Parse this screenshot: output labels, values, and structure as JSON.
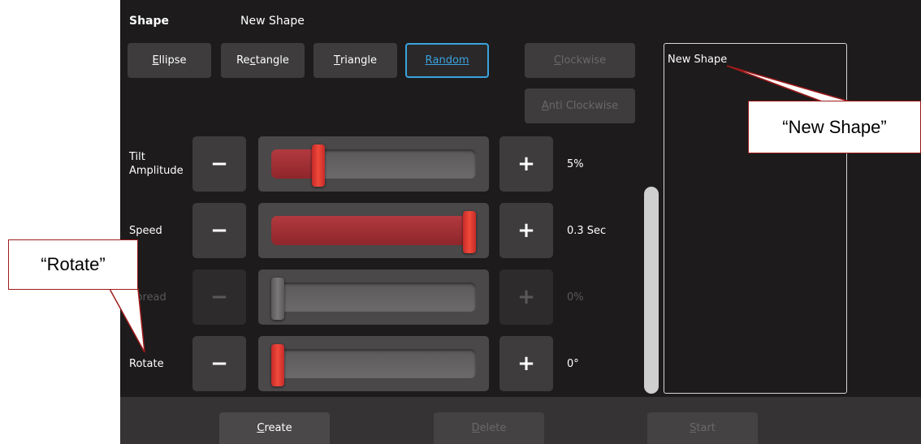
{
  "header": {
    "title": "Shape",
    "shape_name": "New Shape"
  },
  "shape_buttons": [
    {
      "label": "Ellipse",
      "mnemonic": "E",
      "rest": "llipse",
      "state": "normal"
    },
    {
      "label": "Rectangle",
      "pre": "Re",
      "mnemonic": "c",
      "rest": "tangle",
      "state": "normal"
    },
    {
      "label": "Triangle",
      "mnemonic": "T",
      "rest": "riangle",
      "state": "normal"
    },
    {
      "label": "Random",
      "mnemonic": "R",
      "rest": "andom",
      "state": "selected"
    }
  ],
  "direction_buttons": [
    {
      "label": "Clockwise",
      "mnemonic": "C",
      "rest": "lockwise",
      "state": "disabled"
    },
    {
      "label": "Anti Clockwise",
      "mnemonic": "A",
      "rest": "nti Clockwise",
      "state": "disabled"
    }
  ],
  "sliders": [
    {
      "label_line1": "Tilt",
      "label_line2": "Amplitude",
      "value_text": "5%",
      "level": 0.21,
      "enabled": true
    },
    {
      "label_line1": "Speed",
      "label_line2": "",
      "value_text": "0.3 Sec",
      "level": 1.0,
      "enabled": true
    },
    {
      "label_line1": "Spread",
      "label_line2": "",
      "value_text": "0%",
      "level": 0.0,
      "enabled": false
    },
    {
      "label_line1": "Rotate",
      "label_line2": "",
      "value_text": "0°",
      "level": 0.0,
      "enabled": true
    }
  ],
  "controls": {
    "minus": "−",
    "plus": "+"
  },
  "shape_list": {
    "items": [
      "New Shape"
    ]
  },
  "bottom_buttons": [
    {
      "label": "Create",
      "mnemonic": "C",
      "rest": "reate",
      "state": "normal"
    },
    {
      "label": "Delete",
      "mnemonic": "D",
      "rest": "elete",
      "state": "disabled"
    },
    {
      "label": "Start",
      "mnemonic": "S",
      "rest": "tart",
      "state": "disabled"
    }
  ],
  "callouts": {
    "new_shape": "“New Shape”",
    "rotate": "“Rotate”"
  },
  "colors": {
    "accent_selected": "#3aa3e0",
    "slider_red": "#e8413a",
    "callout_border": "#9e1b1b",
    "background": "#1d1b1c"
  }
}
